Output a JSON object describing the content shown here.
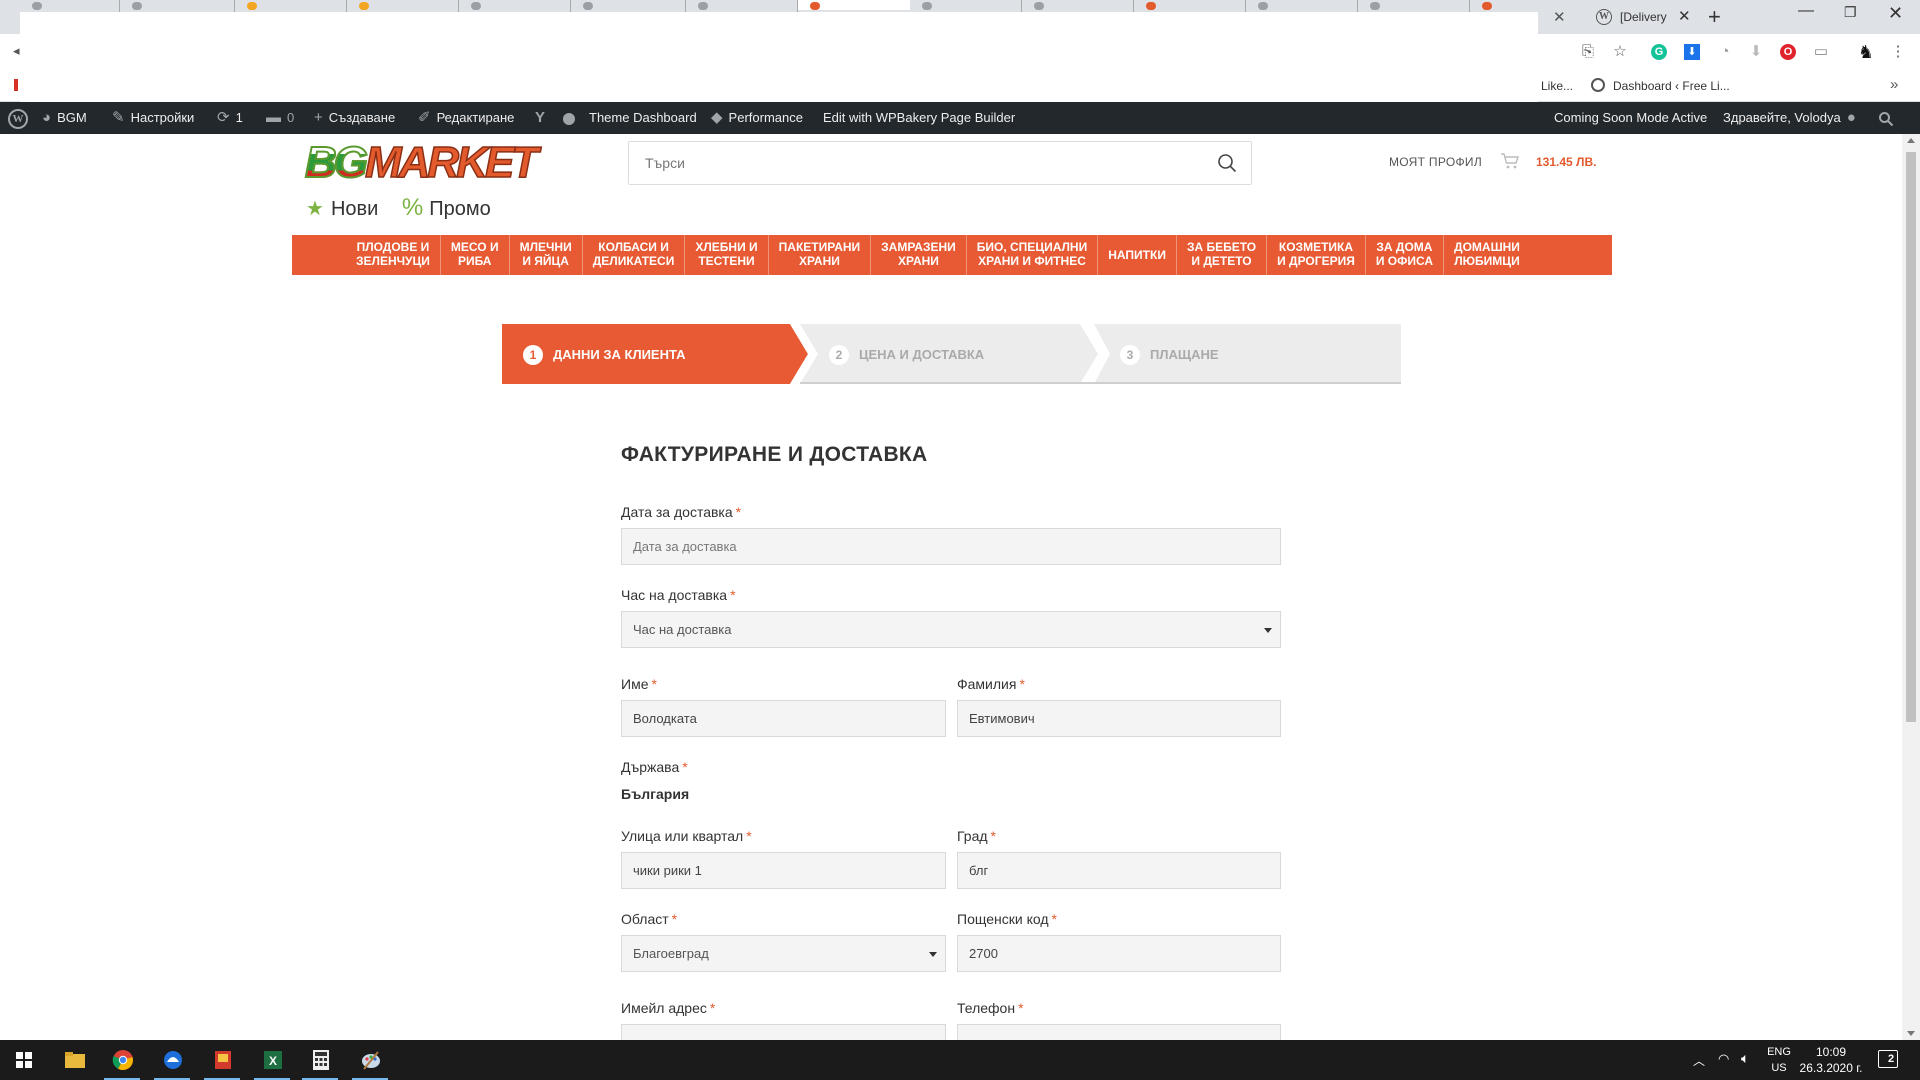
{
  "browser": {
    "active_tab_title": "[Delivery",
    "bookmark_likes": "Like...",
    "bookmark_dashboard": "Dashboard ‹ Free Li..."
  },
  "adminbar": {
    "site": "BGM",
    "settings": "Настройки",
    "updates": "1",
    "comments": "0",
    "create": "Създаване",
    "edit": "Редактиране",
    "theme_dashboard": "Theme Dashboard",
    "performance": "Performance",
    "wpbakery": "Edit with WPBakery Page Builder",
    "coming_soon": "Coming Soon Mode Active",
    "greeting": "Здравейте, Volodya"
  },
  "header": {
    "logo_part1": "BG",
    "logo_part2": "MARKET",
    "new_label": "Нови",
    "promo_label": "Промо",
    "search_placeholder": "Търси",
    "my_profile": "МОЯТ ПРОФИЛ",
    "cart_total": "131.45 ЛВ."
  },
  "categories": [
    [
      "ПЛОДОВЕ И",
      "ЗЕЛЕНЧУЦИ"
    ],
    [
      "МЕСО И",
      "РИБА"
    ],
    [
      "МЛЕЧНИ",
      "И ЯЙЦА"
    ],
    [
      "КОЛБАСИ И",
      "ДЕЛИКАТЕСИ"
    ],
    [
      "ХЛЕБНИ И",
      "ТЕСТЕНИ"
    ],
    [
      "ПАКЕТИРАНИ",
      "ХРАНИ"
    ],
    [
      "ЗАМРАЗЕНИ",
      "ХРАНИ"
    ],
    [
      "БИО, СПЕЦИАЛНИ",
      "ХРАНИ И ФИТНЕС"
    ],
    [
      "НАПИТКИ"
    ],
    [
      "ЗА БЕБЕТО",
      "И ДЕТЕТО"
    ],
    [
      "КОЗМЕТИКА",
      "И ДРОГЕРИЯ"
    ],
    [
      "ЗА ДОМА",
      "И ОФИСА"
    ],
    [
      "ДОМАШНИ",
      "ЛЮБИМЦИ"
    ]
  ],
  "steps": [
    {
      "num": "1",
      "label": "ДАННИ ЗА КЛИЕНТА"
    },
    {
      "num": "2",
      "label": "ЦЕНА И ДОСТАВКА"
    },
    {
      "num": "3",
      "label": "ПЛАЩАНЕ"
    }
  ],
  "form": {
    "title": "ФАКТУРИРАНЕ И ДОСТАВКА",
    "required_mark": "*",
    "delivery_date": {
      "label": "Дата за доставка",
      "placeholder": "Дата за доставка",
      "value": ""
    },
    "delivery_hour": {
      "label": "Час на доставка",
      "value": "Час на доставка"
    },
    "first_name": {
      "label": "Име",
      "value": "Володката"
    },
    "last_name": {
      "label": "Фамилия",
      "value": "Евтимович"
    },
    "country": {
      "label": "Държава",
      "value": "България"
    },
    "street": {
      "label": "Улица или квартал",
      "value": "чики рики 1"
    },
    "city": {
      "label": "Град",
      "value": "блг"
    },
    "region": {
      "label": "Област",
      "value": "Благоевград"
    },
    "postcode": {
      "label": "Пощенски код",
      "value": "2700"
    },
    "email": {
      "label": "Имейл адрес"
    },
    "phone": {
      "label": "Телефон"
    }
  },
  "taskbar": {
    "lang_line1": "ENG",
    "lang_line2": "US",
    "time": "10:09",
    "date": "26.3.2020 г.",
    "notifications": "2"
  },
  "colors": {
    "brand_orange": "#e75a33",
    "admin_bar": "#23282d",
    "step_inactive": "#ececec"
  }
}
